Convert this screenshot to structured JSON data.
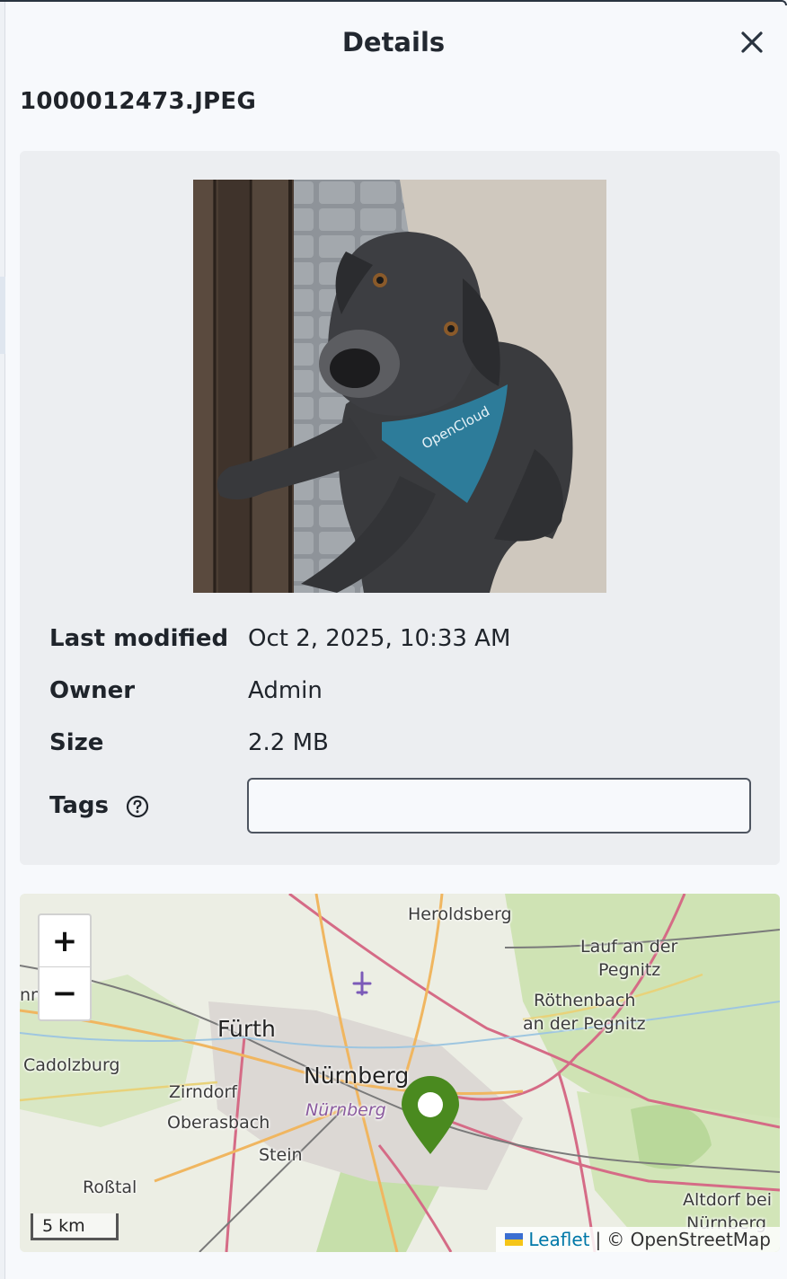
{
  "header": {
    "title": "Details",
    "close_icon": "close-icon"
  },
  "file": {
    "name": "1000012473.JPEG"
  },
  "preview": {
    "bandana_text": "OpenCloud"
  },
  "metadata": {
    "last_modified_label": "Last modified",
    "last_modified_value": "Oct 2, 2025, 10:33 AM",
    "owner_label": "Owner",
    "owner_value": "Admin",
    "size_label": "Size",
    "size_value": "2.2 MB",
    "tags_label": "Tags",
    "tags_help_icon": "help-circle-icon",
    "tags_value": ""
  },
  "map": {
    "zoom_in_label": "+",
    "zoom_out_label": "−",
    "scale_label": "5 km",
    "attribution_leaflet": "Leaflet",
    "attribution_separator": "|",
    "attribution_osm": "© OpenStreetMap",
    "marker_color": "#4a8a1f",
    "places": {
      "heroldsberg": "Heroldsberg",
      "lauf_1": "Lauf an der",
      "lauf_2": "Pegnitz",
      "roethenbach_1": "Röthenbach",
      "roethenbach_2": "an der Pegnitz",
      "fuerth": "Fürth",
      "cadolzburg": "Cadolzburg",
      "nuernberg": "Nürnberg",
      "nuernberg_small": "Nürnberg",
      "zirndorf": "Zirndorf",
      "oberasbach": "Oberasbach",
      "stein": "Stein",
      "rosstal": "Roßtal",
      "altdorf_1": "Altdorf bei",
      "altdorf_2": "Nürnberg",
      "cut_left": "nn"
    }
  }
}
